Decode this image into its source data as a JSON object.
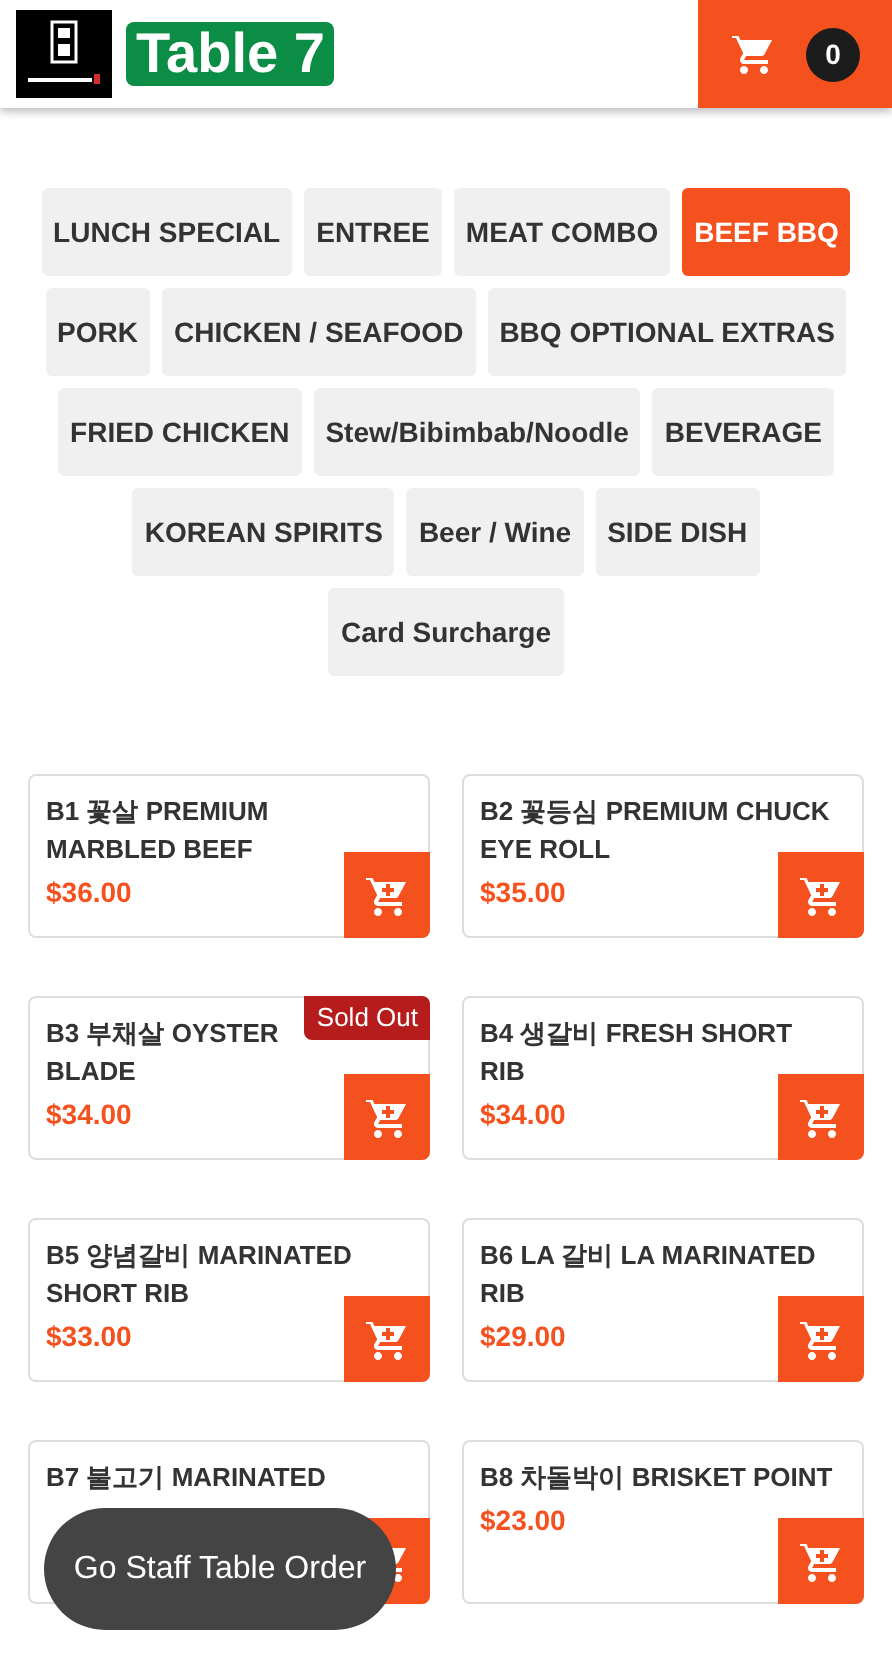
{
  "header": {
    "table_label": "Table 7",
    "cart_count": "0"
  },
  "categories": [
    {
      "label": "LUNCH SPECIAL",
      "selected": false
    },
    {
      "label": "ENTREE",
      "selected": false
    },
    {
      "label": "MEAT COMBO",
      "selected": false
    },
    {
      "label": "BEEF BBQ",
      "selected": true
    },
    {
      "label": "PORK",
      "selected": false
    },
    {
      "label": "CHICKEN / SEAFOOD",
      "selected": false
    },
    {
      "label": "BBQ OPTIONAL EXTRAS",
      "selected": false
    },
    {
      "label": "FRIED CHICKEN",
      "selected": false
    },
    {
      "label": "Stew/Bibimbab/Noodle",
      "selected": false
    },
    {
      "label": "BEVERAGE",
      "selected": false
    },
    {
      "label": "KOREAN SPIRITS",
      "selected": false
    },
    {
      "label": "Beer / Wine",
      "selected": false
    },
    {
      "label": "SIDE DISH",
      "selected": false
    },
    {
      "label": "Card Surcharge",
      "selected": false
    }
  ],
  "items": [
    {
      "name": "B1 꽃살 PREMIUM MARBLED BEEF",
      "price": "$36.00"
    },
    {
      "name": "B2 꽃등심 PREMIUM CHUCK EYE ROLL",
      "price": "$35.00"
    },
    {
      "name": "B3 부채살 OYSTER BLADE",
      "price": "$34.00",
      "badge": "Sold Out"
    },
    {
      "name": "B4 생갈비 FRESH SHORT RIB",
      "price": "$34.00"
    },
    {
      "name": "B5 양념갈비 MARINATED SHORT RIB",
      "price": "$33.00"
    },
    {
      "name": "B6 LA 갈비 LA MARINATED RIB",
      "price": "$29.00"
    },
    {
      "name": "B7 불고기 MARINATED"
    },
    {
      "name": "B8 차돌박이 BRISKET POINT",
      "price": "$23.00"
    }
  ],
  "toast": {
    "text": "Go Staff Table Order"
  }
}
